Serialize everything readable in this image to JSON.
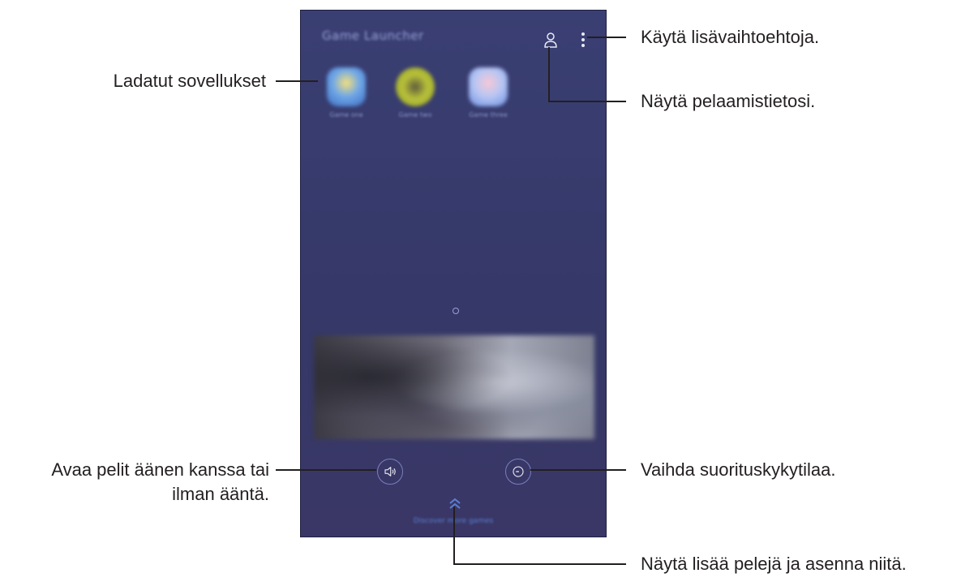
{
  "phone": {
    "app_title": "Game Launcher",
    "games": [
      {
        "label": "Game one",
        "icon": "game-icon-blue"
      },
      {
        "label": "Game two",
        "icon": "game-icon-yellow"
      },
      {
        "label": "Game three",
        "icon": "game-icon-pastel"
      }
    ],
    "bottom_text": "Discover more games"
  },
  "callouts": {
    "more_options": "Käytä lisävaihtoehtoja.",
    "profile": "Näytä pelaamistietosi.",
    "downloaded_apps": "Ladatut sovellukset",
    "sound_line1": "Avaa pelit äänen kanssa tai",
    "sound_line2": "ilman ääntä.",
    "performance": "Vaihda suorituskykytilaa.",
    "more_games": "Näytä lisää pelejä ja asenna niitä."
  },
  "icons": [
    "profile-icon",
    "more-options-icon",
    "sound-icon",
    "performance-icon",
    "chevron-up-icon"
  ],
  "colors": {
    "screen_bg": "#363a6c",
    "accent": "#5a7fd3",
    "text": "#231f20"
  }
}
